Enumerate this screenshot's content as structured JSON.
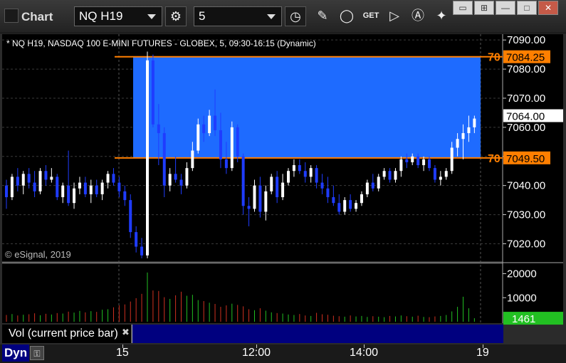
{
  "window": {
    "title": "Chart",
    "symbol": "NQ H19",
    "interval": "5",
    "buttons": [
      "clock-icon",
      "pencil-icon",
      "study-icon",
      "get-icon",
      "play-icon",
      "alert-icon",
      "link-icon"
    ],
    "window_controls": [
      "restore",
      "maximize",
      "minimize",
      "close"
    ],
    "get_label": "GET"
  },
  "chart_data": {
    "type": "candlestick",
    "header": "* NQ H19, NASDAQ 100 E-MINI FUTURES - GLOBEX, 5, 09:30-16:15 (Dynamic)",
    "copyright": "© eSignal, 2019",
    "ylim": [
      7014,
      7092
    ],
    "yticks": [
      7020.0,
      7030.0,
      7040.0,
      7050.0,
      7060.0,
      7070.0,
      7080.0,
      7090.0
    ],
    "ytick_labels": [
      "7020.00",
      "7030.00",
      "7040.00",
      "7050.00",
      "7060.00",
      "7070.00",
      "7080.00",
      "7090.00"
    ],
    "xtick_labels": [
      "15",
      "12:00",
      "14:00",
      "19"
    ],
    "levels": [
      {
        "value": 7084.25,
        "label": "7084.25",
        "marker": "70"
      },
      {
        "value": 7049.5,
        "label": "7049.50",
        "marker": "70"
      }
    ],
    "last_price": {
      "value": 7064.0,
      "label": "7064.00"
    },
    "bars": [
      [
        7040,
        7042,
        7032,
        7036
      ],
      [
        7036,
        7044,
        7035,
        7043
      ],
      [
        7043,
        7046,
        7038,
        7040
      ],
      [
        7040,
        7045,
        7037,
        7044
      ],
      [
        7044,
        7046,
        7039,
        7041
      ],
      [
        7041,
        7045,
        7036,
        7038
      ],
      [
        7038,
        7046,
        7037,
        7045
      ],
      [
        7045,
        7047,
        7040,
        7042
      ],
      [
        7042,
        7046,
        7041,
        7043
      ],
      [
        7043,
        7044,
        7035,
        7036
      ],
      [
        7036,
        7041,
        7034,
        7040
      ],
      [
        7040,
        7052,
        7033,
        7034
      ],
      [
        7034,
        7041,
        7032,
        7039
      ],
      [
        7039,
        7043,
        7037,
        7041
      ],
      [
        7041,
        7043,
        7036,
        7037
      ],
      [
        7037,
        7042,
        7034,
        7040
      ],
      [
        7040,
        7042,
        7036,
        7037
      ],
      [
        7037,
        7042,
        7035,
        7041
      ],
      [
        7041,
        7045,
        7039,
        7044
      ],
      [
        7044,
        7046,
        7040,
        7041
      ],
      [
        7041,
        7043,
        7036,
        7038
      ],
      [
        7038,
        7040,
        7033,
        7035
      ],
      [
        7035,
        7037,
        7022,
        7024
      ],
      [
        7024,
        7026,
        7017,
        7019
      ],
      [
        7019,
        7022,
        7015,
        7016
      ],
      [
        7016,
        7086,
        7015,
        7083
      ],
      [
        7083,
        7085,
        7060,
        7061
      ],
      [
        7061,
        7068,
        7047,
        7058
      ],
      [
        7058,
        7060,
        7036,
        7040
      ],
      [
        7040,
        7046,
        7038,
        7044
      ],
      [
        7044,
        7050,
        7041,
        7042
      ],
      [
        7042,
        7044,
        7037,
        7040
      ],
      [
        7040,
        7048,
        7039,
        7046
      ],
      [
        7046,
        7055,
        7045,
        7052
      ],
      [
        7052,
        7063,
        7051,
        7061
      ],
      [
        7061,
        7064,
        7055,
        7058
      ],
      [
        7058,
        7066,
        7057,
        7064
      ],
      [
        7064,
        7073,
        7057,
        7059
      ],
      [
        7059,
        7065,
        7046,
        7049
      ],
      [
        7049,
        7055,
        7044,
        7046
      ],
      [
        7046,
        7062,
        7045,
        7060
      ],
      [
        7060,
        7061,
        7048,
        7050
      ],
      [
        7050,
        7051,
        7030,
        7033
      ],
      [
        7033,
        7036,
        7026,
        7032
      ],
      [
        7032,
        7042,
        7031,
        7040
      ],
      [
        7040,
        7043,
        7029,
        7031
      ],
      [
        7031,
        7040,
        7028,
        7038
      ],
      [
        7038,
        7044,
        7037,
        7043
      ],
      [
        7043,
        7045,
        7034,
        7036
      ],
      [
        7036,
        7044,
        7035,
        7041
      ],
      [
        7041,
        7046,
        7040,
        7045
      ],
      [
        7045,
        7049,
        7043,
        7047
      ],
      [
        7047,
        7049,
        7044,
        7045
      ],
      [
        7045,
        7048,
        7041,
        7043
      ],
      [
        7043,
        7047,
        7041,
        7046
      ],
      [
        7046,
        7047,
        7039,
        7041
      ],
      [
        7041,
        7044,
        7037,
        7039
      ],
      [
        7039,
        7043,
        7034,
        7036
      ],
      [
        7036,
        7040,
        7033,
        7034
      ],
      [
        7034,
        7037,
        7030,
        7031
      ],
      [
        7031,
        7036,
        7030,
        7035
      ],
      [
        7035,
        7037,
        7031,
        7032
      ],
      [
        7032,
        7035,
        7031,
        7034
      ],
      [
        7034,
        7038,
        7033,
        7037
      ],
      [
        7037,
        7042,
        7036,
        7041
      ],
      [
        7041,
        7044,
        7038,
        7039
      ],
      [
        7039,
        7044,
        7038,
        7043
      ],
      [
        7043,
        7046,
        7042,
        7045
      ],
      [
        7045,
        7046,
        7041,
        7042
      ],
      [
        7042,
        7046,
        7041,
        7045
      ],
      [
        7045,
        7050,
        7043,
        7049
      ],
      [
        7049,
        7051,
        7046,
        7048
      ],
      [
        7048,
        7051,
        7047,
        7050
      ],
      [
        7050,
        7051,
        7046,
        7047
      ],
      [
        7047,
        7050,
        7045,
        7049
      ],
      [
        7049,
        7050,
        7045,
        7046
      ],
      [
        7046,
        7047,
        7041,
        7042
      ],
      [
        7042,
        7045,
        7040,
        7043
      ],
      [
        7043,
        7046,
        7042,
        7045
      ],
      [
        7045,
        7055,
        7044,
        7053
      ],
      [
        7053,
        7058,
        7050,
        7056
      ],
      [
        7056,
        7061,
        7049,
        7058
      ],
      [
        7058,
        7064,
        7055,
        7060
      ],
      [
        7060,
        7064,
        7058,
        7063
      ]
    ],
    "volume": {
      "ylim": [
        0,
        24000
      ],
      "yticks": [
        10000,
        20000
      ],
      "ytick_labels": [
        "10000",
        "20000"
      ],
      "last": {
        "value": 1461,
        "label": "1461"
      },
      "values": [
        2800,
        3200,
        2600,
        2900,
        3100,
        3500,
        2700,
        3300,
        3000,
        3600,
        3400,
        4200,
        3800,
        4500,
        3900,
        4400,
        4100,
        5000,
        5200,
        6000,
        6800,
        7200,
        8400,
        9800,
        11600,
        20500,
        13000,
        12800,
        10200,
        9500,
        11000,
        12500,
        10800,
        11200,
        9000,
        8600,
        7900,
        7400,
        6200,
        6800,
        7500,
        7000,
        6400,
        5200,
        4800,
        5600,
        4600,
        3900,
        3600,
        3400,
        3000,
        2800,
        3200,
        2600,
        2400,
        3700,
        3100,
        2900,
        2500,
        2300,
        2100,
        2600,
        2200,
        2400,
        2000,
        2300,
        2100,
        1900,
        2400,
        2200,
        2600,
        2300,
        2100,
        2500,
        2000,
        1900,
        2200,
        2400,
        2800,
        4300,
        6200,
        10400,
        5600,
        1461
      ]
    },
    "volume_legend": "Vol (current price bar)"
  },
  "colors": {
    "band": "#1e6bff",
    "level": "#ff7f00",
    "up": "#ffffff",
    "down": "#1f3cff",
    "vol_up": "#22c022",
    "vol_down": "#d03020",
    "last_vol_bg": "#22c022"
  },
  "footer": {
    "mode": "Dyn"
  }
}
